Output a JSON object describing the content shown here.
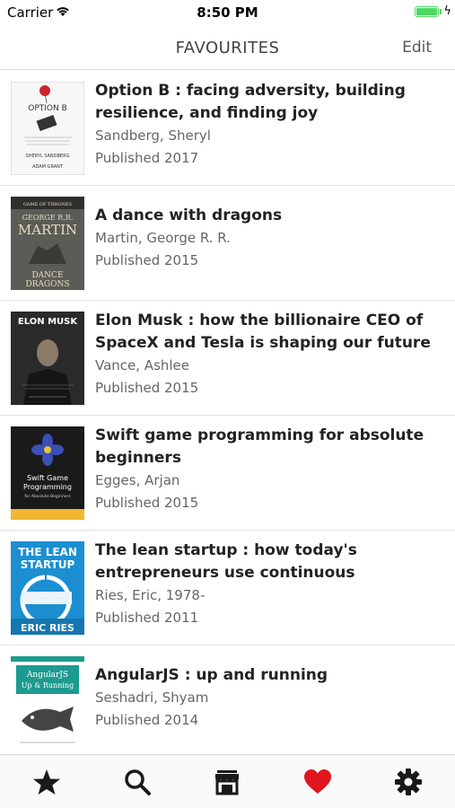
{
  "status_bar": {
    "carrier": "Carrier",
    "time": "8:50 PM",
    "charging_symbol": "ϟ"
  },
  "nav": {
    "title": "FAVOURITES",
    "edit_label": "Edit"
  },
  "books": [
    {
      "title": "Option B : facing adversity, building resilience, and finding joy",
      "author": "Sandberg, Sheryl",
      "published": "Published 2017",
      "cover": {
        "text_top": "OPTION B",
        "text_mid": "SHERYL SANDBERG",
        "text_bottom": "ADAM GRANT",
        "bg": "#f7f7f5",
        "accent": "#d0242b"
      }
    },
    {
      "title": "A dance with dragons",
      "author": "Martin, George R. R.",
      "published": "Published 2015",
      "cover": {
        "text_top": "GEORGE R.R.",
        "text_mid": "MARTIN",
        "text_bottom": "DANCE DRAGONS",
        "bg": "#5a5c55",
        "accent": "#e6dcc1"
      }
    },
    {
      "title": "Elon Musk : how the billionaire CEO of SpaceX and Tesla is shaping our future",
      "author": "Vance, Ashlee",
      "published": "Published 2015",
      "cover": {
        "text_top": "ELON MUSK",
        "bg": "#2a2a2a",
        "accent": "#ffffff"
      }
    },
    {
      "title": "Swift game programming for absolute beginners",
      "author": "Egges, Arjan",
      "published": "Published 2015",
      "cover": {
        "text_top": "Swift Game",
        "text_mid": "Programming",
        "text_bottom": "for Absolute Beginners",
        "bg": "#1a1a1a",
        "accent": "#f2b632"
      }
    },
    {
      "title": "The lean startup : how today's entrepreneurs use continuous innovation…",
      "author": "Ries, Eric, 1978-",
      "published": "Published 2011",
      "cover": {
        "text_top": "THE LEAN",
        "text_mid": "STARTUP",
        "text_bottom": "ERIC RIES",
        "bg": "#1b8fd1",
        "accent": "#ffffff"
      }
    },
    {
      "title": "AngularJS : up and running",
      "author": "Seshadri, Shyam",
      "published": "Published 2014",
      "cover": {
        "text_top": "AngularJS",
        "text_mid": "Up & Running",
        "bg": "#ffffff",
        "accent": "#1d9b8f"
      }
    }
  ],
  "tabs": [
    {
      "name": "favorites-star-icon",
      "active": false
    },
    {
      "name": "search-icon",
      "active": false
    },
    {
      "name": "store-icon",
      "active": false
    },
    {
      "name": "heart-icon",
      "active": true
    },
    {
      "name": "settings-gear-icon",
      "active": false
    }
  ],
  "colors": {
    "heart_active": "#e0161e",
    "icon_dark": "#1a1a1a",
    "battery": "#4cd964"
  }
}
